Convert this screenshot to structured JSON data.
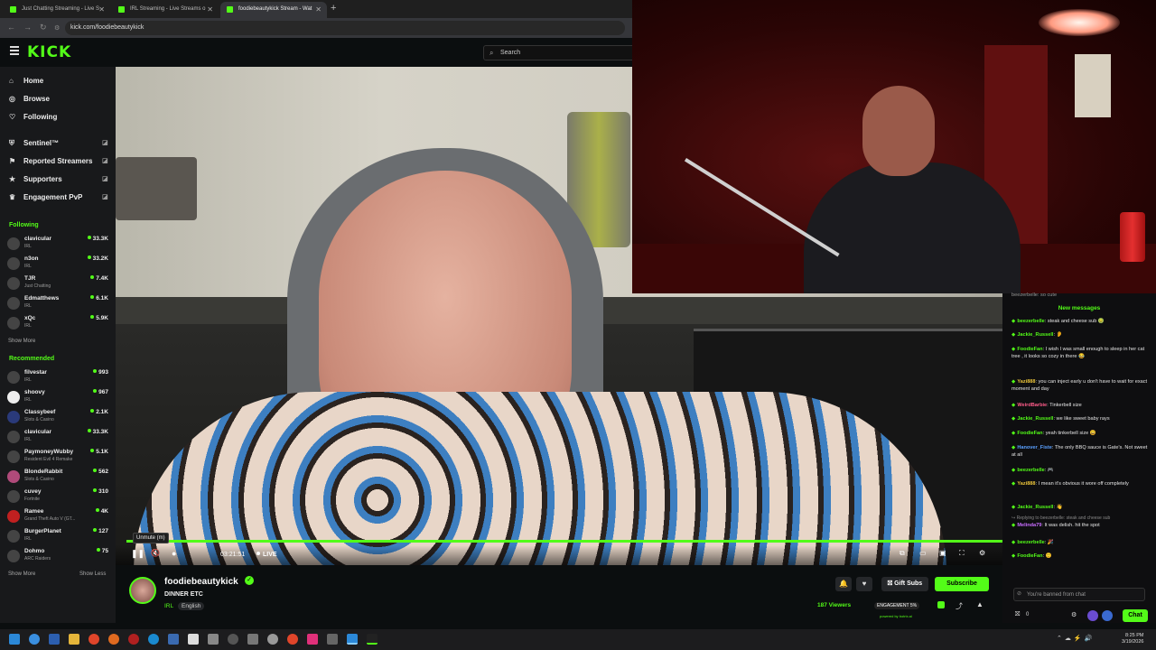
{
  "browser": {
    "tabs": [
      {
        "label": "Just Chatting Streaming - Live S"
      },
      {
        "label": "IRL Streaming - Live Streams o"
      },
      {
        "label": "foodiebeautykick Stream - Wat"
      }
    ],
    "url": "kick.com/foodiebeautykick"
  },
  "header": {
    "logo": "KICK",
    "search_placeholder": "Search"
  },
  "sidebar": {
    "nav": [
      {
        "label": "Home",
        "icon": "home-icon"
      },
      {
        "label": "Browse",
        "icon": "browse-icon"
      },
      {
        "label": "Following",
        "icon": "heart-icon"
      },
      {
        "label": "Sentinel™",
        "icon": "shield-icon"
      },
      {
        "label": "Reported Streamers",
        "icon": "flag-icon"
      },
      {
        "label": "Supporters",
        "icon": "star-icon"
      },
      {
        "label": "Engagement PvP",
        "icon": "trophy-icon"
      }
    ],
    "following_title": "Following",
    "following": [
      {
        "name": "clavicular",
        "category": "IRL",
        "viewers": "33.3K"
      },
      {
        "name": "n3on",
        "category": "IRL",
        "viewers": "33.2K"
      },
      {
        "name": "TJR",
        "category": "Just Chatting",
        "viewers": "7.4K"
      },
      {
        "name": "Edmatthews",
        "category": "IRL",
        "viewers": "6.1K"
      },
      {
        "name": "xQc",
        "category": "IRL",
        "viewers": "5.9K"
      }
    ],
    "show_more": "Show More",
    "recommended_title": "Recommended",
    "recommended": [
      {
        "name": "filvestar",
        "category": "IRL",
        "viewers": "993"
      },
      {
        "name": "shoovy",
        "category": "IRL",
        "viewers": "967"
      },
      {
        "name": "Classybeef",
        "category": "Slots & Casino",
        "viewers": "2.1K"
      },
      {
        "name": "clavicular",
        "category": "IRL",
        "viewers": "33.3K"
      },
      {
        "name": "PaymoneyWubby",
        "category": "Resident Evil 4 Remake",
        "viewers": "5.1K"
      },
      {
        "name": "BlondeRabbit",
        "category": "Slots & Casino",
        "viewers": "562"
      },
      {
        "name": "cuvey",
        "category": "Fortnite",
        "viewers": "310"
      },
      {
        "name": "Ramee",
        "category": "Grand Theft Auto V (GT...",
        "viewers": "4K"
      },
      {
        "name": "BurgerPlanet",
        "category": "IRL",
        "viewers": "127"
      },
      {
        "name": "Dohmo",
        "category": "ARC Raiders",
        "viewers": "75"
      }
    ],
    "show_more2": "Show More",
    "show_less": "Show Less"
  },
  "player": {
    "tooltip": "Unmute (m)",
    "time": "03:21:51",
    "live": "LIVE",
    "progress": 1.0
  },
  "stream": {
    "channel": "foodiebeautykick",
    "title": "DINNER ETC",
    "category": "IRL",
    "language": "English",
    "viewers": "187 Viewers",
    "engagement": "ENGAGEMENT 5%",
    "powered": "powered by botrix.ai",
    "gift_subs": "Gift Subs",
    "subscribe": "Subscribe"
  },
  "chat": {
    "top_partial": "beezerbelle: so cute",
    "new_messages": "New messages",
    "messages": [
      {
        "user": "beezerbelle",
        "color": "#53fc18",
        "text": "steak and cheese sub 🤢"
      },
      {
        "user": "Jackie_Russell",
        "color": "#53fc18",
        "text": "👂"
      },
      {
        "user": "FoodieFan",
        "color": "#53fc18",
        "text": "I wish I was small enough to sleep in her cat tree , it looks so cozy in there 😂"
      },
      {
        "user": "Yazi888",
        "color": "#e8c23a",
        "text": "you can inject early u don't have to wait for exact moment and day"
      },
      {
        "user": "WeirdBarbie",
        "color": "#ff5c8a",
        "text": "Tinkerbell size"
      },
      {
        "user": "Jackie_Russell",
        "color": "#53fc18",
        "text": "we like sweet baby rays"
      },
      {
        "user": "FoodieFan",
        "color": "#53fc18",
        "text": "yeah tinkerbell size 😄"
      },
      {
        "user": "Hanover_Fiste",
        "color": "#5aa0ff",
        "text": "The only BBQ sauce is Gate's. Not sweet at all"
      },
      {
        "user": "beezerbelle",
        "color": "#53fc18",
        "text": "🎮"
      },
      {
        "user": "Yazi888",
        "color": "#e8c23a",
        "text": "I mean it's obvious it wore off completely"
      },
      {
        "user": "Jackie_Russell",
        "color": "#53fc18",
        "text": "👋"
      },
      {
        "user": "Melinda79",
        "color": "#c86cff",
        "text": "It was delish. hit the spot",
        "reply": "Replying to beezerbelle: steak and cheese sub"
      },
      {
        "user": "beezerbelle",
        "color": "#53fc18",
        "text": "🎉"
      },
      {
        "user": "FoodieFan",
        "color": "#53fc18",
        "text": "🙂"
      }
    ],
    "input_placeholder": "You're banned from chat",
    "chat_button": "Chat",
    "count": "0"
  },
  "taskbar": {
    "time": "8:25 PM",
    "date": "3/19/2026"
  }
}
